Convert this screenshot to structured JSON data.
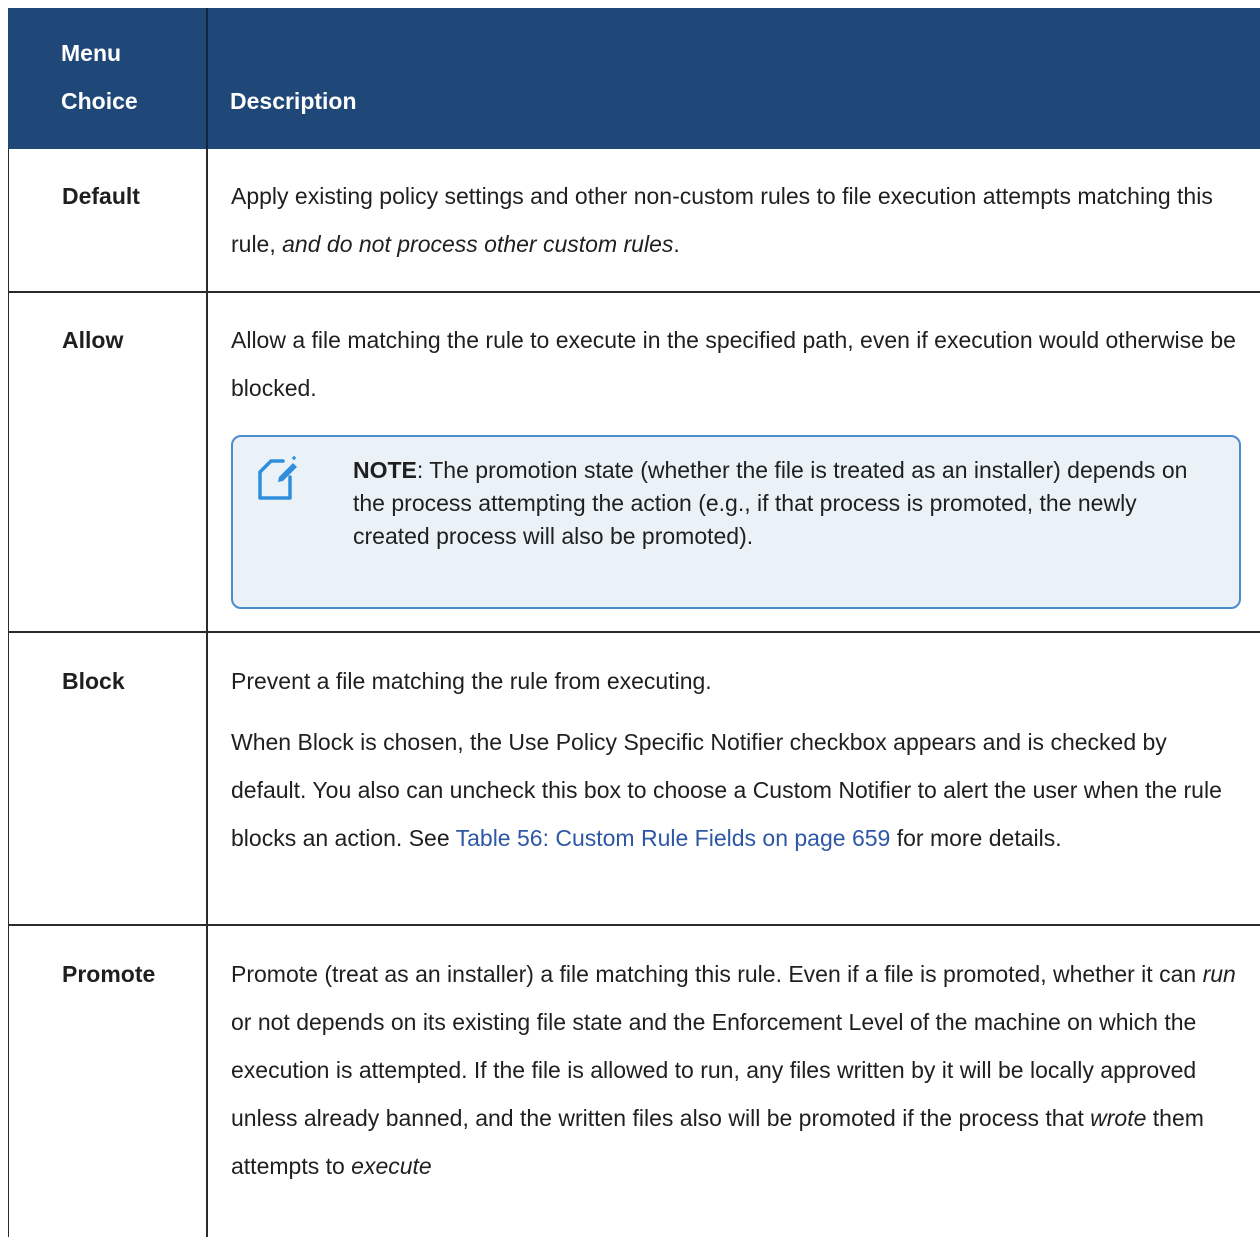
{
  "header": {
    "col1_line1": "Menu",
    "col1_line2": "Choice",
    "col2": "Description"
  },
  "rows": [
    {
      "choice": "Default",
      "desc_plain": "Apply existing policy settings and other non-custom rules to file execution attempts matching this rule, ",
      "desc_italic": "and do not process other custom rules",
      "desc_end": "."
    },
    {
      "choice": "Allow",
      "desc": "Allow a file matching the rule to execute in the specified path, even if execution would otherwise be blocked.",
      "note": {
        "icon": "note-icon",
        "label": "NOTE",
        "text": ": The promotion state (whether the file is treated as an installer) depends on the process attempting the action (e.g., if that process is promoted, the newly created process will also be promoted)."
      }
    },
    {
      "choice": "Block",
      "desc_p1": "Prevent a file matching the rule from executing.",
      "desc_p2_before": "When Block is chosen, the Use Policy Specific Notifier checkbox appears and is checked by default. You also can uncheck this box to choose a Custom Notifier to alert the user when the rule blocks an action. See ",
      "desc_p2_link": "Table 56: Custom Rule Fields on page 659",
      "desc_p2_after": " for more details."
    },
    {
      "choice": "Promote",
      "seg1": "Promote (treat as an installer) a file matching this rule. Even if a file is promoted, whether it can ",
      "seg2_italic": "run",
      "seg3": " or not depends on its existing file state and the Enforcement Level of the machine on which the execution is attempted. If the file is allowed to run, any files written by it will be locally approved unless already banned, and the written files also will be promoted if the process that ",
      "seg4_italic": "wrote",
      "seg5": " them attempts to ",
      "seg6_italic": "execute"
    }
  ],
  "colors": {
    "header_bg": "#1f4777",
    "link": "#2e57a6",
    "note_border": "#4a8ccc",
    "note_bg": "#eaf2f8"
  }
}
